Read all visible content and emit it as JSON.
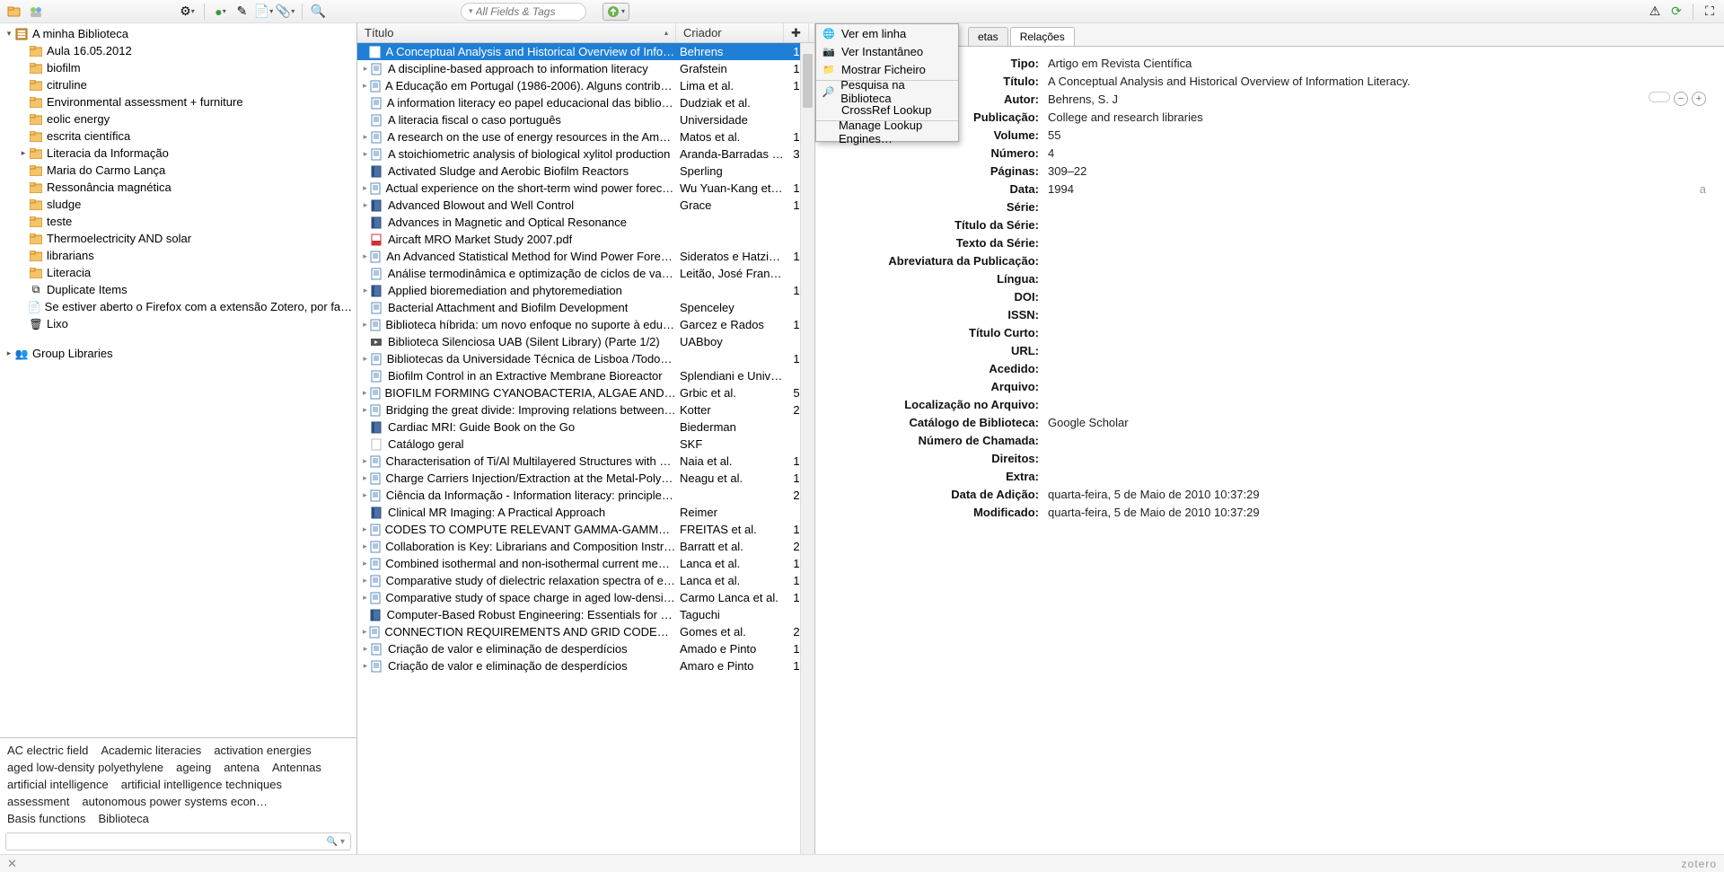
{
  "search": {
    "placeholder": "All Fields & Tags"
  },
  "library": {
    "root": "A minha Biblioteca",
    "folders": [
      "Aula 16.05.2012",
      "biofilm",
      "citruline",
      "Environmental assessment + furniture",
      "eolic energy",
      "escrita científica",
      "Literacia da Informação",
      "Maria do Carmo Lança",
      "Ressonância magnética",
      "sludge",
      "teste",
      "Thermoelectricity AND solar",
      "librarians",
      "Literacia"
    ],
    "dup": "Duplicate Items",
    "unfiled": "Se estiver aberto o Firefox com a extensão Zotero, por favor fech…",
    "trash": "Lixo",
    "group": "Group Libraries"
  },
  "tags": [
    "AC electric field",
    "Academic literacies",
    "activation energies",
    "aged low-density polyethylene",
    "ageing",
    "antena",
    "Antennas",
    "artificial intelligence",
    "artificial intelligence techniques",
    "assessment",
    "autonomous power systems econ…",
    "Basis functions",
    "Biblioteca"
  ],
  "columns": {
    "title": "Título",
    "creator": "Criador"
  },
  "items": [
    {
      "t": "A Conceptual Analysis and Historical Overview of Informatio…",
      "c": "Behrens",
      "a": "1",
      "sel": true,
      "exp": false,
      "ic": "note"
    },
    {
      "t": "A discipline-based approach to information literacy",
      "c": "Grafstein",
      "a": "1",
      "exp": true,
      "ic": "art"
    },
    {
      "t": "A Educação em Portugal (1986-2006). Alguns contributos de …",
      "c": "Lima et al.",
      "a": "1",
      "exp": true,
      "ic": "art"
    },
    {
      "t": "A information literacy eo papel educacional das bibliotecas",
      "c": "Dudziak et al.",
      "a": "",
      "exp": false,
      "ic": "art"
    },
    {
      "t": "A literacia fiscal o caso português",
      "c": "Universidade",
      "a": "",
      "exp": false,
      "ic": "art"
    },
    {
      "t": "A research on the use of energy resources in the Amazon",
      "c": "Matos et al.",
      "a": "1",
      "exp": true,
      "ic": "art"
    },
    {
      "t": "A stoichiometric analysis of biological xylitol production",
      "c": "Aranda-Barradas et al.",
      "a": "3",
      "exp": true,
      "ic": "art"
    },
    {
      "t": "Activated Sludge and Aerobic Biofilm Reactors",
      "c": "Sperling",
      "a": "",
      "exp": false,
      "ic": "book"
    },
    {
      "t": "Actual experience on the short-term wind power forecasting …",
      "c": "Wu Yuan-Kang et al.",
      "a": "1",
      "exp": true,
      "ic": "art"
    },
    {
      "t": "Advanced Blowout and Well Control",
      "c": "Grace",
      "a": "1",
      "exp": true,
      "ic": "book"
    },
    {
      "t": "Advances in Magnetic and Optical Resonance",
      "c": "",
      "a": "",
      "exp": false,
      "ic": "book"
    },
    {
      "t": "Aircaft MRO Market Study 2007.pdf",
      "c": "",
      "a": "",
      "exp": false,
      "ic": "pdf"
    },
    {
      "t": "An Advanced Statistical Method for Wind Power Forecasting",
      "c": "Sideratos e Hatziargy…",
      "a": "1",
      "exp": true,
      "ic": "art"
    },
    {
      "t": "Análise termodinâmica e optimização de ciclos de vapor",
      "c": "Leitão, José Francisco…",
      "a": "",
      "exp": false,
      "ic": "art"
    },
    {
      "t": "Applied bioremediation and phytoremediation",
      "c": "",
      "a": "1",
      "exp": true,
      "ic": "book"
    },
    {
      "t": "Bacterial Attachment and Biofilm Development",
      "c": "Spenceley",
      "a": "",
      "exp": false,
      "ic": "art"
    },
    {
      "t": "Biblioteca híbrida: um novo enfoque no suporte à educação …",
      "c": "Garcez e Rados",
      "a": "1",
      "exp": true,
      "ic": "art"
    },
    {
      "t": "Biblioteca Silenciosa UAB (Silent Library) (Parte 1/2)",
      "c": "UABboy",
      "a": "",
      "exp": false,
      "ic": "video"
    },
    {
      "t": "Bibliotecas da Universidade Técnica de Lisboa /Todos Loc.",
      "c": "",
      "a": "1",
      "exp": true,
      "ic": "art"
    },
    {
      "t": "Biofilm Control in an Extractive Membrane Bioreactor",
      "c": "Splendiani e University",
      "a": "",
      "exp": false,
      "ic": "art"
    },
    {
      "t": "BIOFILM FORMING CYANOBACTERIA, ALGAE AND FUNGI O…",
      "c": "Grbic et al.",
      "a": "5",
      "exp": true,
      "ic": "art"
    },
    {
      "t": "Bridging the great divide: Improving relations between librar…",
      "c": "Kotter",
      "a": "2",
      "exp": true,
      "ic": "art"
    },
    {
      "t": "Cardiac MRI: Guide Book on the Go",
      "c": "Biederman",
      "a": "",
      "exp": false,
      "ic": "book"
    },
    {
      "t": "Catálogo geral",
      "c": "SKF",
      "a": "",
      "exp": false,
      "ic": "doc"
    },
    {
      "t": "Characterisation of Ti/Al Multilayered Structures with Slow P…",
      "c": "Naia et al.",
      "a": "1",
      "exp": true,
      "ic": "art"
    },
    {
      "t": "Charge Carriers Injection/Extraction at the Metal-Polymer Int…",
      "c": "Neagu et al.",
      "a": "1",
      "exp": true,
      "ic": "art"
    },
    {
      "t": "Ciência da Informação - Information literacy: principles, phil…",
      "c": "",
      "a": "2",
      "exp": true,
      "ic": "art"
    },
    {
      "t": "Clinical MR Imaging: A Practical Approach",
      "c": "Reimer",
      "a": "",
      "exp": false,
      "ic": "book"
    },
    {
      "t": "CODES TO COMPUTE RELEVANT GAMMA-GAMMA AND GA…",
      "c": "FREITAS et al.",
      "a": "1",
      "exp": true,
      "ic": "art"
    },
    {
      "t": "Collaboration is Key: Librarians and Composition Instructors …",
      "c": "Barratt et al.",
      "a": "2",
      "exp": true,
      "ic": "art"
    },
    {
      "t": "Combined isothermal and non-isothermal current measurem…",
      "c": "Lanca et al.",
      "a": "1",
      "exp": true,
      "ic": "art"
    },
    {
      "t": "Comparative study of dielectric relaxation spectra of electric…",
      "c": "Lanca et al.",
      "a": "1",
      "exp": true,
      "ic": "art"
    },
    {
      "t": "Comparative study of space charge in aged low-density poly…",
      "c": "Carmo Lanca et al.",
      "a": "1",
      "exp": true,
      "ic": "art"
    },
    {
      "t": "Computer-Based Robust Engineering: Essentials for DFSS",
      "c": "Taguchi",
      "a": "",
      "exp": false,
      "ic": "book"
    },
    {
      "t": "CONNECTION REQUIREMENTS AND GRID CODES FOR DIST…",
      "c": "Gomes et al.",
      "a": "2",
      "exp": true,
      "ic": "art"
    },
    {
      "t": "Criação de valor e eliminação de desperdícios",
      "c": "Amado e Pinto",
      "a": "1",
      "exp": true,
      "ic": "art"
    },
    {
      "t": "Criação de valor e eliminação de desperdícios",
      "c": "Amaro e Pinto",
      "a": "1",
      "exp": true,
      "ic": "art"
    }
  ],
  "menu": {
    "view_online": "Ver em linha",
    "snapshot": "Ver Instantâneo",
    "show_file": "Mostrar Ficheiro",
    "lib_search": "Pesquisa na Biblioteca",
    "crossref": "CrossRef Lookup",
    "manage": "Manage Lookup Engines…"
  },
  "tabs": {
    "etas": "etas",
    "relations": "Relações"
  },
  "meta": {
    "labels": {
      "type": "Tipo:",
      "title": "Título:",
      "author": "Autor:",
      "pub": "Publicação:",
      "vol": "Volume:",
      "num": "Número:",
      "pages": "Páginas:",
      "date": "Data:",
      "series": "Série:",
      "stitle": "Título da Série:",
      "stext": "Texto da Série:",
      "abbrev": "Abreviatura da Publicação:",
      "lang": "Língua:",
      "doi": "DOI:",
      "issn": "ISSN:",
      "short": "Título Curto:",
      "url": "URL:",
      "accessed": "Acedido:",
      "archive": "Arquivo:",
      "loc": "Localização no Arquivo:",
      "cat": "Catálogo de Biblioteca:",
      "call": "Número de Chamada:",
      "rights": "Direitos:",
      "extra": "Extra:",
      "added": "Data de Adição:",
      "mod": "Modificado:"
    },
    "values": {
      "type": "Artigo em Revista Científica",
      "title": "A Conceptual Analysis and Historical Overview of Information Literacy.",
      "author": "Behrens, S. J",
      "pub": "College and research libraries",
      "vol": "55",
      "num": "4",
      "pages": "309–22",
      "date": "1994",
      "date_extra": "a",
      "cat": "Google Scholar",
      "added": "quarta-feira, 5 de Maio de 2010 10:37:29",
      "mod": "quarta-feira, 5 de Maio de 2010 10:37:29"
    }
  },
  "branding": "zotero"
}
